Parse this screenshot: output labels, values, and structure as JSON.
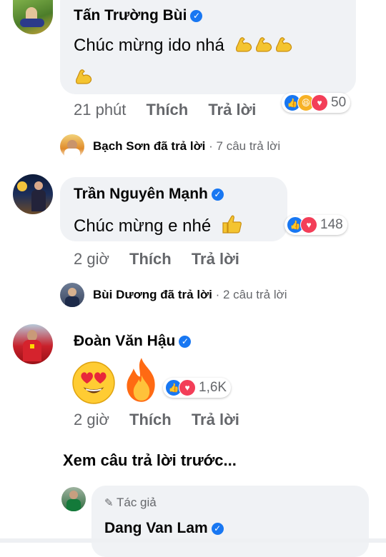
{
  "comments": [
    {
      "author": "Tấn Trường Bùi",
      "text": "Chúc mừng ido nhá",
      "time": "21 phút",
      "like_label": "Thích",
      "reply_label": "Trả lời",
      "reaction_count": "50"
    },
    {
      "author": "Trần Nguyên Mạnh",
      "text": "Chúc mừng e nhé",
      "time": "2 giờ",
      "like_label": "Thích",
      "reply_label": "Trả lời",
      "reaction_count": "148"
    },
    {
      "author": "Đoàn Văn Hậu",
      "text": "",
      "time": "2 giờ",
      "like_label": "Thích",
      "reply_label": "Trả lời",
      "reaction_count": "1,6K"
    }
  ],
  "reply_summaries": [
    {
      "name": "Bạch Sơn",
      "action": "đã trả lời",
      "count": "· 7 câu trả lời"
    },
    {
      "name": "Bùi Dương",
      "action": "đã trả lời",
      "count": "· 2 câu trả lời"
    }
  ],
  "see_previous": "Xem câu trả lời trước...",
  "author_reply": {
    "badge": "Tác giả",
    "name": "Dang Van Lam"
  },
  "colors": {
    "bubble": "#f0f2f5",
    "like_blue": "#1877f2",
    "love_red": "#f33e58",
    "meta_gray": "#65676b"
  },
  "icons": {
    "verified": "verified-badge-icon",
    "muscle": "flexed-biceps-emoji",
    "thumbs_up": "thumbs-up-emoji",
    "heart_eyes": "heart-eyes-emoji",
    "fire": "fire-emoji",
    "pencil": "pencil-icon"
  }
}
